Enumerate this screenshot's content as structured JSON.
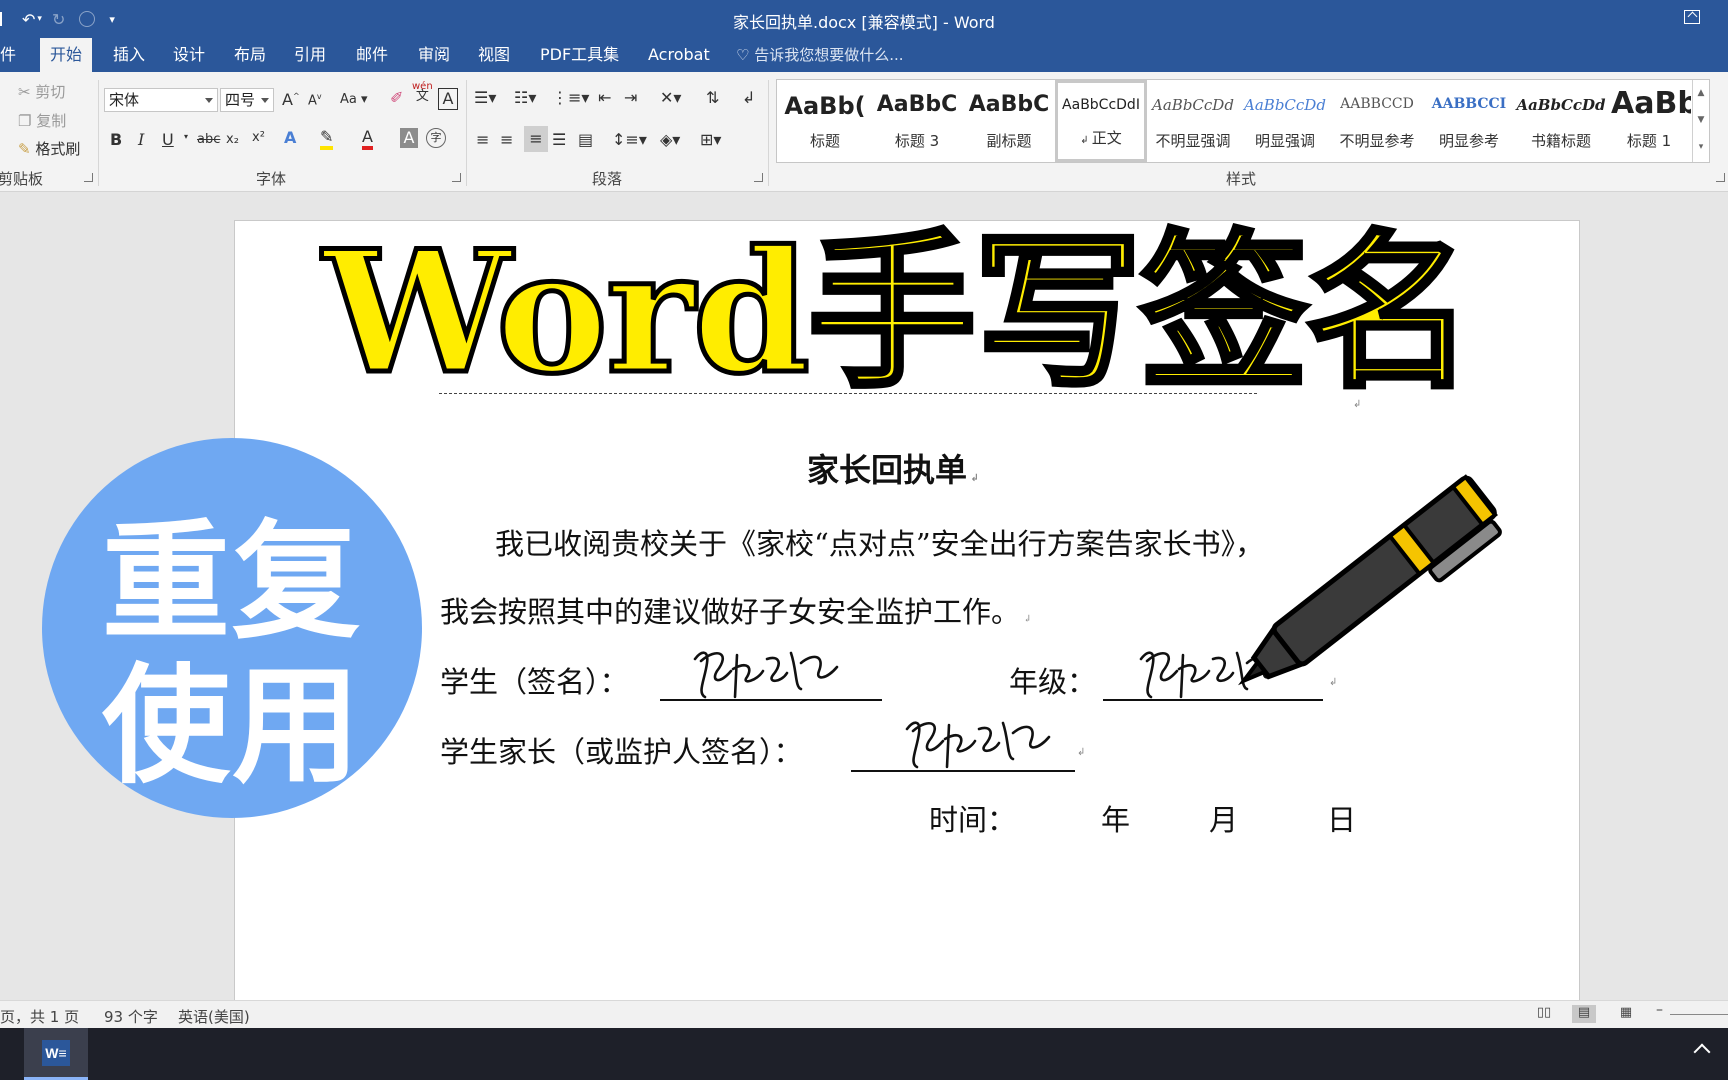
{
  "window": {
    "title": "家长回执单.docx [兼容模式] - Word"
  },
  "quick_access": {
    "file_fragment": "",
    "undo": "↶",
    "redo": "↻",
    "more": "▾"
  },
  "tabs": [
    {
      "label": "件"
    },
    {
      "label": "开始",
      "active": true
    },
    {
      "label": "插入"
    },
    {
      "label": "设计"
    },
    {
      "label": "布局"
    },
    {
      "label": "引用"
    },
    {
      "label": "邮件"
    },
    {
      "label": "审阅"
    },
    {
      "label": "视图"
    },
    {
      "label": "PDF工具集"
    },
    {
      "label": "Acrobat"
    }
  ],
  "tell_me": "告诉我您想要做什么...",
  "ribbon": {
    "clipboard": {
      "cut": "剪切",
      "copy": "复制",
      "format_painter": "格式刷",
      "label": "剪贴板"
    },
    "font": {
      "name": "宋体",
      "size": "四号",
      "grow": "A",
      "shrink": "A",
      "case": "Aa",
      "bold": "B",
      "italic": "I",
      "underline": "U",
      "strike": "abc",
      "subscript": "x₂",
      "superscript": "x²",
      "phonetic": "wén",
      "label": "字体"
    },
    "paragraph": {
      "label": "段落"
    },
    "styles": {
      "label": "样式",
      "items": [
        {
          "preview": "AaBb(",
          "name": "标题"
        },
        {
          "preview": "AaBbC",
          "name": "标题 3"
        },
        {
          "preview": "AaBbC",
          "name": "副标题"
        },
        {
          "preview": "AaBbCcDdI",
          "name": "正文",
          "selected": true
        },
        {
          "preview": "AaBbCcDd",
          "name": "不明显强调"
        },
        {
          "preview": "AaBbCcDd",
          "name": "明显强调"
        },
        {
          "preview": "AABBCCD",
          "name": "不明显参考"
        },
        {
          "preview": "AABBCCI",
          "name": "明显参考"
        },
        {
          "preview": "AaBbCcDd",
          "name": "书籍标题"
        },
        {
          "preview": "AaBb",
          "name": "标题 1"
        }
      ]
    }
  },
  "document": {
    "banner": "Word手写签名",
    "heading": "家长回执单",
    "para1": "我已收阅贵校关于《家校“点对点”安全出行方案告家长书》，",
    "para2": "我会按照其中的建议做好子女安全监护工作。",
    "student_label": "学生（签名）：",
    "grade_label": "年级：",
    "parent_label": "学生家长（或监护人签名）：",
    "time_label": "时间：",
    "year": "年",
    "month": "月",
    "day": "日",
    "badge_line1": "重复",
    "badge_line2": "使用"
  },
  "statusbar": {
    "page": "页，共 1 页",
    "words": "93 个字",
    "language": "英语(美国)"
  },
  "colors": {
    "brand": "#2b579a",
    "banner_fill": "#ffed00",
    "badge": "#6fa8f2"
  }
}
